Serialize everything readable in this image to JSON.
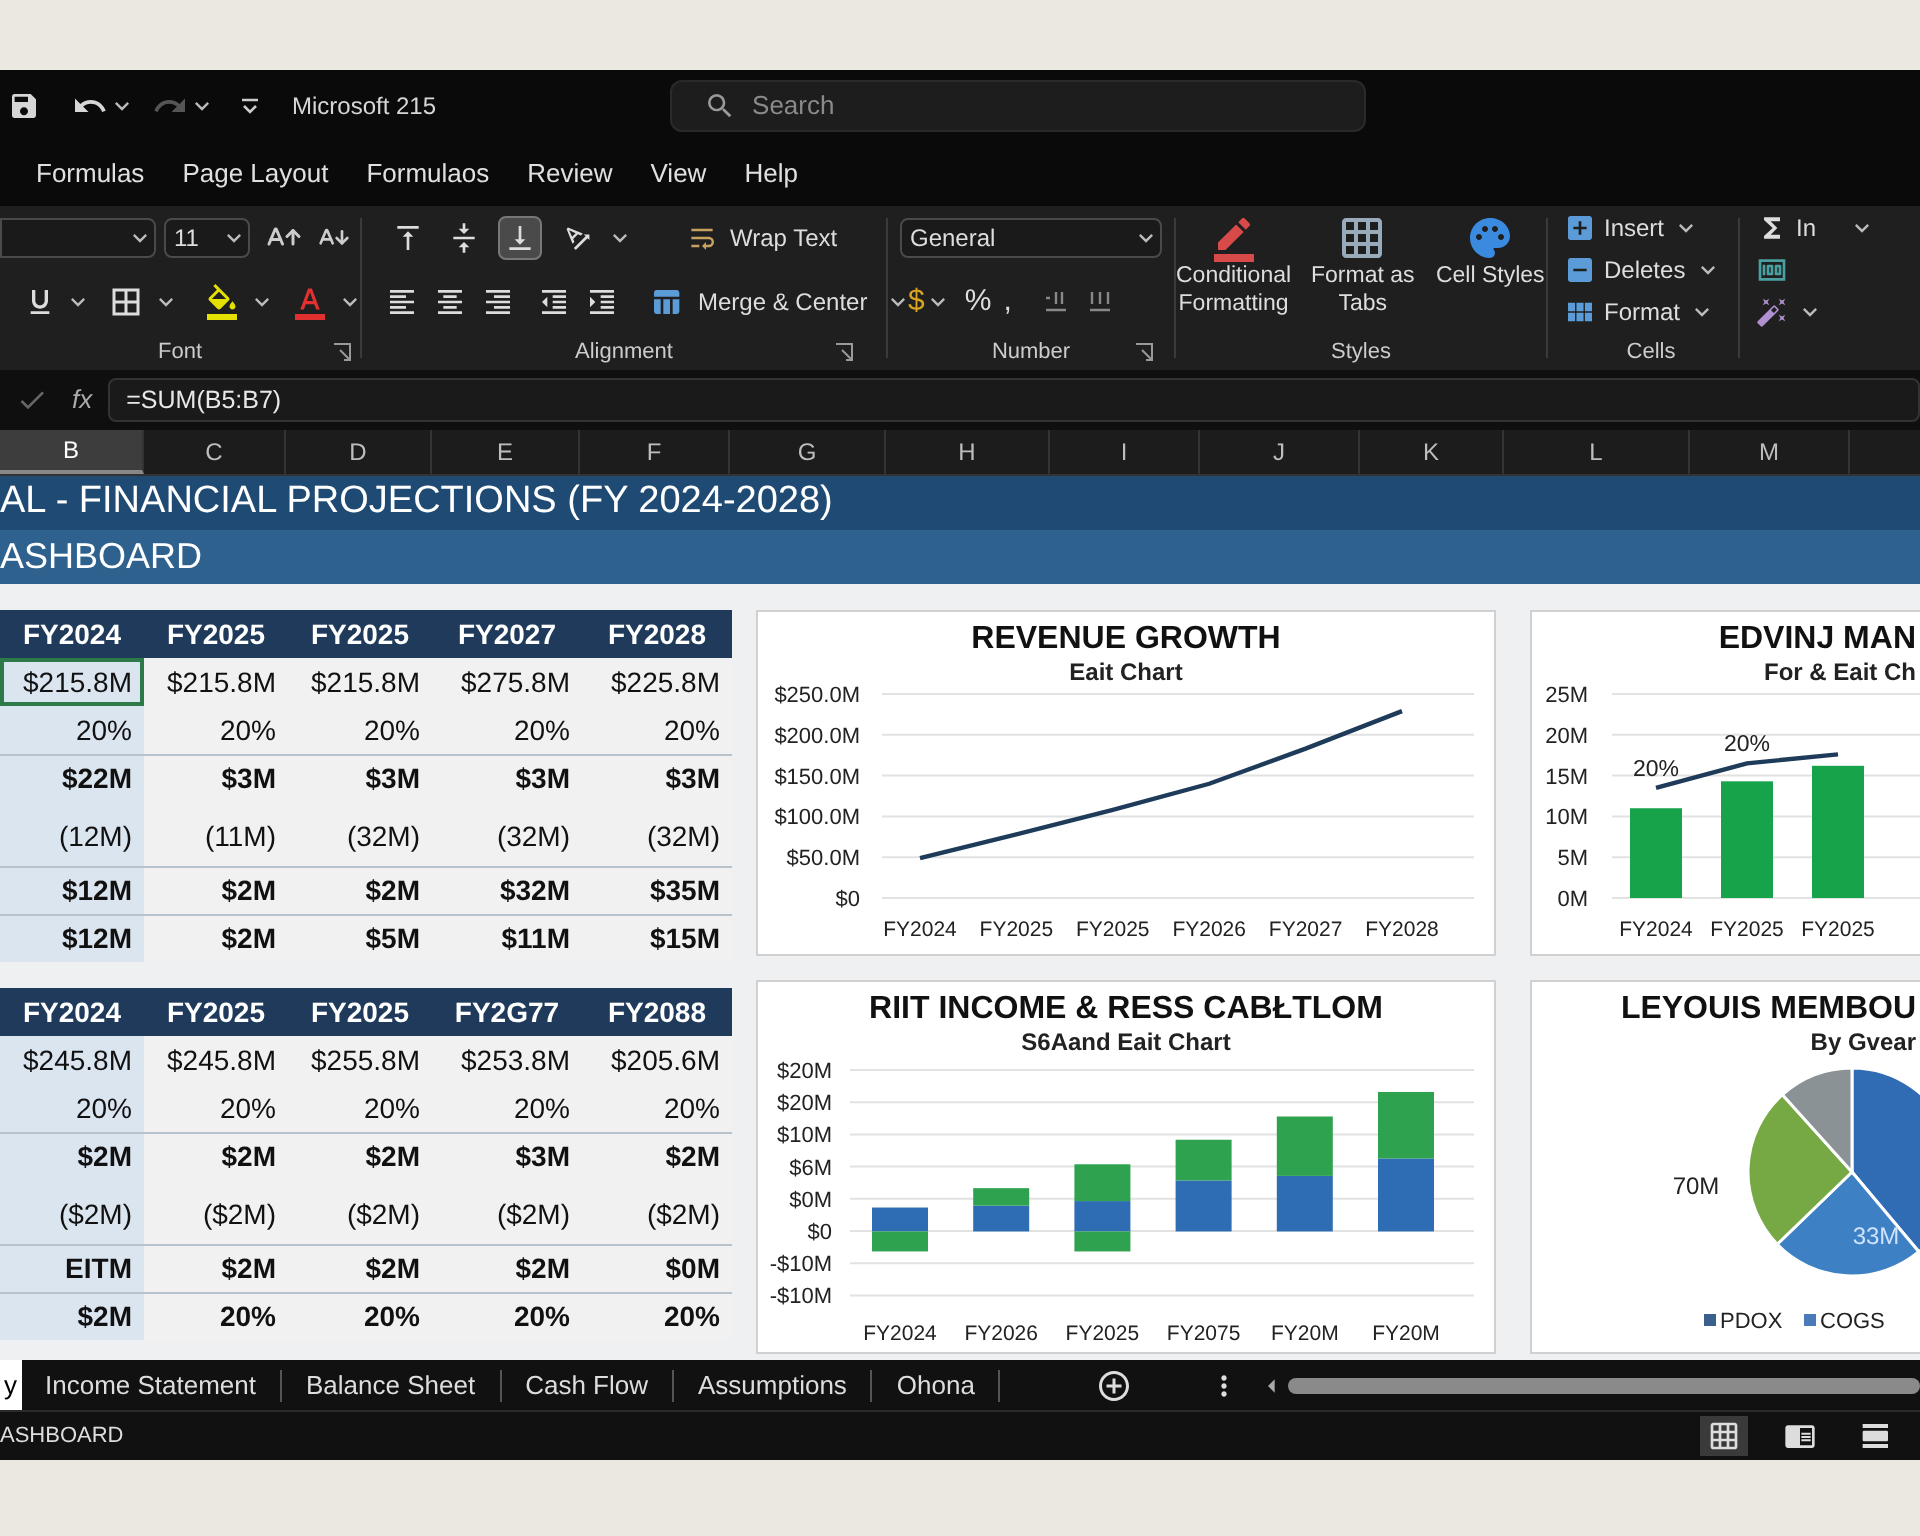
{
  "title_bar": {
    "app_title": "Microsoft 215",
    "search": {
      "placeholder": "Search"
    }
  },
  "menu": [
    "Formulas",
    "Page Layout",
    "Formulaos",
    "Review",
    "View",
    "Help"
  ],
  "ribbon": {
    "font": {
      "size": "11",
      "label": "Font"
    },
    "alignment": {
      "vertical": [
        {
          "selected": false
        },
        {
          "selected": false
        },
        {
          "selected": true
        }
      ],
      "wrap_text": "Wrap Text",
      "merge": "Merge & Center",
      "label": "Alignment"
    },
    "number": {
      "format": "General",
      "symbols": [
        {
          "text": "$",
          "caret": true
        },
        {
          "text": "%",
          "caret": false
        },
        {
          "text": ",",
          "caret": false
        }
      ],
      "label": "Number"
    },
    "styles": {
      "buttons": [
        "Conditional Formatting",
        "Format as Tabs",
        "Cell Styles"
      ],
      "label": "Styles"
    },
    "cells": {
      "buttons": [
        "Insert",
        "Deletes",
        "Format"
      ],
      "label": "Cells"
    },
    "editing": {
      "autosum": "In"
    }
  },
  "formula_bar": {
    "fx": "fx",
    "formula": "=SUM(B5:B7)"
  },
  "columns": [
    {
      "label": "B",
      "selected": true
    },
    {
      "label": "C",
      "selected": false
    },
    {
      "label": "D",
      "selected": false
    },
    {
      "label": "E",
      "selected": false
    },
    {
      "label": "F",
      "selected": false
    },
    {
      "label": "G",
      "selected": false
    },
    {
      "label": "H",
      "selected": false
    },
    {
      "label": "I",
      "selected": false
    },
    {
      "label": "J",
      "selected": false
    },
    {
      "label": "K",
      "selected": false
    },
    {
      "label": "L",
      "selected": false
    },
    {
      "label": "M",
      "selected": false
    }
  ],
  "banner": {
    "title": "AL - FINANCIAL PROJECTIONS (FY 2024-2028)",
    "subtitle": "ASHBOARD"
  },
  "tables": [
    {
      "columns": [
        "FY2024",
        "FY2025",
        "FY2025",
        "FY2027",
        "FY2028"
      ],
      "rows": [
        {
          "kind": "amount",
          "cells": [
            {
              "text": "$215.8M",
              "selected": true
            },
            {
              "text": "$215.8M",
              "selected": false
            },
            {
              "text": "$215.8M",
              "selected": false
            },
            {
              "text": "$275.8M",
              "selected": false
            },
            {
              "text": "$225.8M",
              "selected": false
            }
          ]
        },
        {
          "kind": "amount",
          "cells": [
            {
              "text": "20%",
              "selected": false
            },
            {
              "text": "20%",
              "selected": false
            },
            {
              "text": "20%",
              "selected": false
            },
            {
              "text": "20%",
              "selected": false
            },
            {
              "text": "20%",
              "selected": false
            }
          ]
        },
        {
          "kind": "total",
          "cells": [
            {
              "text": "$22M",
              "selected": false
            },
            {
              "text": "$3M",
              "selected": false
            },
            {
              "text": "$3M",
              "selected": false
            },
            {
              "text": "$3M",
              "selected": false
            },
            {
              "text": "$3M",
              "selected": false
            }
          ]
        },
        {
          "kind": "deduction",
          "cells": [
            {
              "text": "(12M)",
              "selected": false
            },
            {
              "text": "(11M)",
              "selected": false
            },
            {
              "text": "(32M)",
              "selected": false
            },
            {
              "text": "(32M)",
              "selected": false
            },
            {
              "text": "(32M)",
              "selected": false
            }
          ]
        },
        {
          "kind": "total",
          "cells": [
            {
              "text": "$12M",
              "selected": false
            },
            {
              "text": "$2M",
              "selected": false
            },
            {
              "text": "$2M",
              "selected": false
            },
            {
              "text": "$32M",
              "selected": false
            },
            {
              "text": "$35M",
              "selected": false
            }
          ]
        },
        {
          "kind": "total",
          "cells": [
            {
              "text": "$12M",
              "selected": false
            },
            {
              "text": "$2M",
              "selected": false
            },
            {
              "text": "$5M",
              "selected": false
            },
            {
              "text": "$11M",
              "selected": false
            },
            {
              "text": "$15M",
              "selected": false
            }
          ]
        }
      ]
    },
    {
      "columns": [
        "FY2024",
        "FY2025",
        "FY2025",
        "FY2G77",
        "FY2088"
      ],
      "rows": [
        {
          "kind": "amount",
          "cells": [
            {
              "text": "$245.8M",
              "selected": false
            },
            {
              "text": "$245.8M",
              "selected": false
            },
            {
              "text": "$255.8M",
              "selected": false
            },
            {
              "text": "$253.8M",
              "selected": false
            },
            {
              "text": "$205.6M",
              "selected": false
            }
          ]
        },
        {
          "kind": "amount",
          "cells": [
            {
              "text": "20%",
              "selected": false
            },
            {
              "text": "20%",
              "selected": false
            },
            {
              "text": "20%",
              "selected": false
            },
            {
              "text": "20%",
              "selected": false
            },
            {
              "text": "20%",
              "selected": false
            }
          ]
        },
        {
          "kind": "total",
          "cells": [
            {
              "text": "$2M",
              "selected": false
            },
            {
              "text": "$2M",
              "selected": false
            },
            {
              "text": "$2M",
              "selected": false
            },
            {
              "text": "$3M",
              "selected": false
            },
            {
              "text": "$2M",
              "selected": false
            }
          ]
        },
        {
          "kind": "deduction",
          "cells": [
            {
              "text": "($2M)",
              "selected": false
            },
            {
              "text": "($2M)",
              "selected": false
            },
            {
              "text": "($2M)",
              "selected": false
            },
            {
              "text": "($2M)",
              "selected": false
            },
            {
              "text": "($2M)",
              "selected": false
            }
          ]
        },
        {
          "kind": "total",
          "cells": [
            {
              "text": "EITM",
              "selected": false
            },
            {
              "text": "$2M",
              "selected": false
            },
            {
              "text": "$2M",
              "selected": false
            },
            {
              "text": "$2M",
              "selected": false
            },
            {
              "text": "$0M",
              "selected": false
            }
          ]
        },
        {
          "kind": "total",
          "cells": [
            {
              "text": "$2M",
              "selected": false
            },
            {
              "text": "20%",
              "selected": false
            },
            {
              "text": "20%",
              "selected": false
            },
            {
              "text": "20%",
              "selected": false
            },
            {
              "text": "20%",
              "selected": false
            }
          ]
        }
      ]
    }
  ],
  "charts": [
    {
      "title": "REVENUE GROWTH",
      "subtitle": "Eait Chart",
      "chart_data": {
        "type": "line",
        "grid": true,
        "categories": [
          "FY2024",
          "FY2025",
          "FY2025",
          "FY2026",
          "FY2027",
          "FY2028"
        ],
        "series": [
          {
            "color": "#1f3b5a",
            "values": [
              49,
              78,
              108,
              140,
              183,
              229
            ]
          }
        ],
        "ylim": [
          0,
          250
        ],
        "yticks": [
          {
            "value": 0,
            "label": "$0"
          },
          {
            "value": 50,
            "label": "$50.0M"
          },
          {
            "value": 100,
            "label": "$100.0M"
          },
          {
            "value": 150,
            "label": "$150.0M"
          },
          {
            "value": 200,
            "label": "$200.0M"
          },
          {
            "value": 250,
            "label": "$250.0M"
          }
        ]
      }
    },
    {
      "title": "EDVINJ MAN",
      "subtitle": "For & Eait Ch",
      "chart_data": {
        "type": "bar",
        "grid": true,
        "categories": [
          "FY2024",
          "FY2025",
          "FY2025"
        ],
        "series": [
          {
            "type": "bar",
            "color": "#16a34a",
            "values": [
              11,
              14.3,
              16.2
            ]
          },
          {
            "type": "line",
            "color": "#1f3b5a",
            "values": [
              13.5,
              16.5,
              17.6
            ]
          }
        ],
        "ylim": [
          0,
          25
        ],
        "yticks": [
          {
            "value": 0,
            "label": "0M"
          },
          {
            "value": 5,
            "label": "5M"
          },
          {
            "value": 10,
            "label": "10M"
          },
          {
            "value": 15,
            "label": "15M"
          },
          {
            "value": 20,
            "label": "20M"
          },
          {
            "value": 25,
            "label": "25M"
          }
        ],
        "annotations": [
          {
            "text": "20%"
          },
          {
            "text": "20%"
          }
        ]
      }
    },
    {
      "kind": "stacked_picture",
      "title": "RIIT INCOME & RESS CABŁTLOM",
      "subtitle": "S6Aand Eait Chart",
      "y_labels": [
        "$20M",
        "$20M",
        "$10M",
        "$6M",
        "$0M",
        "$0",
        "-$10M",
        "-$10M"
      ],
      "x_labels": [
        "FY2024",
        "FY2026",
        "FY2025",
        "FY2075",
        "FY20M",
        "FY20M"
      ]
    },
    {
      "kind": "pie",
      "title": "LEYOUIS MEMBOU",
      "subtitle": "By Gvear",
      "labels": [
        "70M",
        "33M"
      ],
      "legend": [
        {
          "label": "PDOX",
          "color": "#3b5f8f"
        },
        {
          "label": "COGS",
          "color": "#4a7ab8"
        }
      ]
    }
  ],
  "sheet_tabs": [
    {
      "label": "y",
      "selected": true
    },
    {
      "label": "Income Statement",
      "selected": false
    },
    {
      "label": "Balance Sheet",
      "selected": false
    },
    {
      "label": "Cash Flow",
      "selected": false
    },
    {
      "label": "Assumptions",
      "selected": false
    },
    {
      "label": "Ohona",
      "selected": false
    }
  ],
  "status_bar": {
    "text": "ASHBOARD",
    "views": [
      {
        "kind": "normal",
        "selected": true
      },
      {
        "kind": "page_layout",
        "selected": false
      },
      {
        "kind": "page_break",
        "selected": false
      }
    ]
  }
}
